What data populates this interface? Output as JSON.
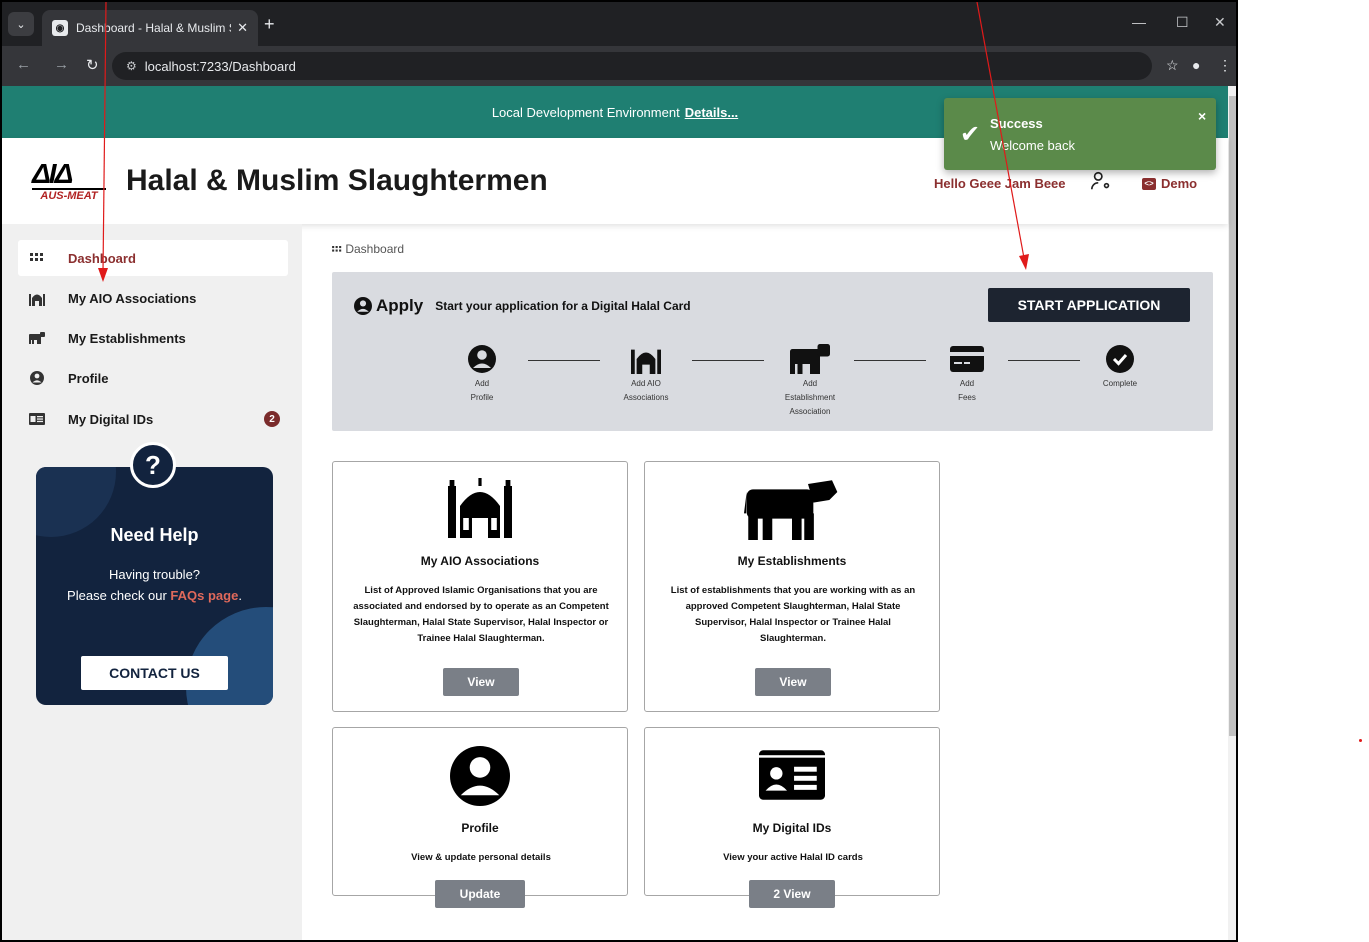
{
  "browser": {
    "tab_title": "Dashboard - Halal & Muslim Sl",
    "url": "localhost:7233/Dashboard"
  },
  "env_bar": {
    "text": "Local Development Environment",
    "link": "Details..."
  },
  "header": {
    "logo_text": "AUS-MEAT",
    "title": "Halal & Muslim Slaughtermen",
    "greeting": "Hello Geee Jam Beee",
    "demo_label": "Demo"
  },
  "toast": {
    "title": "Success",
    "message": "Welcome back",
    "close": "×"
  },
  "sidebar": {
    "items": [
      {
        "label": "Dashboard",
        "icon": "grid-icon"
      },
      {
        "label": "My AIO Associations",
        "icon": "mosque-icon"
      },
      {
        "label": "My Establishments",
        "icon": "cow-icon"
      },
      {
        "label": "Profile",
        "icon": "user-circle-icon"
      },
      {
        "label": "My Digital IDs",
        "icon": "id-card-icon",
        "badge": "2"
      }
    ],
    "help": {
      "icon": "?",
      "title": "Need Help",
      "line1": "Having trouble?",
      "line2_prefix": "Please check our",
      "link": "FAQs page",
      "line2_suffix": ".",
      "button": "CONTACT US"
    }
  },
  "breadcrumb": "Dashboard",
  "apply": {
    "title": "Apply",
    "subtitle": "Start your application for a Digital Halal Card",
    "button": "START APPLICATION",
    "steps": [
      {
        "label1": "Add",
        "label2": "Profile",
        "label3": ""
      },
      {
        "label1": "Add AIO",
        "label2": "Associations",
        "label3": ""
      },
      {
        "label1": "Add",
        "label2": "Establishment",
        "label3": "Association"
      },
      {
        "label1": "Add",
        "label2": "Fees",
        "label3": ""
      },
      {
        "label1": "Complete",
        "label2": "",
        "label3": ""
      }
    ]
  },
  "cards": [
    {
      "title": "My AIO Associations",
      "desc": "List of Approved Islamic Organisations that you are associated and endorsed by to operate as an Competent Slaughterman, Halal State Supervisor, Halal Inspector or Trainee Halal Slaughterman.",
      "button": "View"
    },
    {
      "title": "My Establishments",
      "desc": "List of establishments that you are working with as an approved Competent Slaughterman, Halal State Supervisor, Halal Inspector or Trainee Halal Slaughterman.",
      "button": "View"
    },
    {
      "title": "Profile",
      "desc": "View & update personal details",
      "button": "Update"
    },
    {
      "title": "My Digital IDs",
      "desc": "View your active Halal ID cards",
      "button": "2 View"
    }
  ],
  "colors": {
    "env_bar": "#1f7f72",
    "brand_maroon": "#8b2f2f",
    "toast": "#5b8a4a",
    "help_card": "#12233e",
    "start_button": "#1d2430",
    "card_button": "#7a7f87"
  }
}
